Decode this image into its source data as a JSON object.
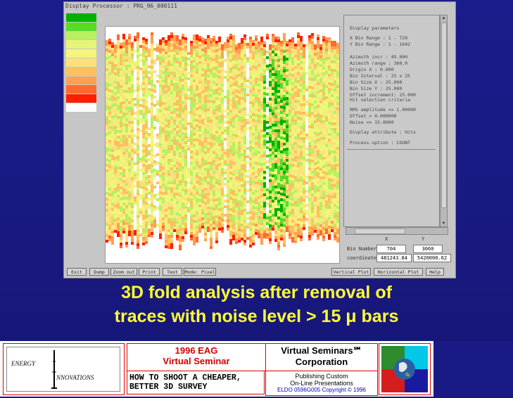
{
  "app": {
    "title": "Display Processor : PRG_96_000111",
    "legend_labels": [
      "",
      "",
      "",
      "",
      "",
      "",
      "",
      "",
      "",
      "",
      ""
    ],
    "legend_colors": [
      "#00b000",
      "#55dd22",
      "#b8f060",
      "#e6f57a",
      "#f5f57a",
      "#ffe080",
      "#ffc060",
      "#ffa050",
      "#ff6a30",
      "#ff1e00",
      "#ffffff"
    ],
    "panel": {
      "heading": "Display parameters",
      "lines": [
        "X Bin Range : 1 - 729",
        "Y Bin Range : 1 - 1642",
        "",
        "Azimuth incr   : 45.000",
        "Azimuth range  : 360.0",
        "Origin X       : 0.000",
        "Bin Interval   : 25 x 25",
        "Bin Size  X    : 25.000",
        "Bin Size  Y    : 25.000",
        "Offset increment: 25.000"
      ],
      "selection_heading": "Hit selection criteria",
      "selection_lines": [
        "RMS amplitude <= 1.00000",
        "Offset  > 0.000000",
        "Noise  <= 15.0000"
      ],
      "display_line": "Display attribute : Hits",
      "process_line": "Process option : COUNT"
    },
    "coords": {
      "x_label": "X",
      "y_label": "Y",
      "bin_number_label": "Bin Number",
      "bin_x": "704",
      "bin_y": "3060",
      "coordinates_label": "coordinates",
      "coord_x": "481243.84",
      "coord_y": "5420000.62"
    },
    "buttons": [
      "Exit",
      "Dump",
      "Zoom out",
      "Print",
      "Text",
      "Mode: Pixel",
      "Vertical Plot",
      "Horizontal Plot",
      "Help"
    ],
    "colors": {
      "window": "#c6c6c6",
      "plot_bg": "#ffffff",
      "legend_top": "#00b000",
      "legend_hot": "#ff1e00"
    }
  },
  "caption": {
    "line1": "3D fold analysis after removal of",
    "line2": "traces with noise level > 15 μ bars"
  },
  "footer": {
    "energy_line1": "ENERGY",
    "energy_line2": "NNOVATIONS",
    "eag_line1": "1996 EAG",
    "eag_line2": "Virtual Seminar",
    "shoot_line1": "HOW TO SHOOT A CHEAPER,",
    "shoot_line2": "BETTER 3D SURVEY",
    "vs_line1": "Virtual Seminars℠",
    "vs_line2": "Corporation",
    "pub_line1": "Publishing Custom",
    "pub_line2": "On-Line Presentations",
    "copyright": "ELDO 0596G005 Copyright © 1996"
  }
}
